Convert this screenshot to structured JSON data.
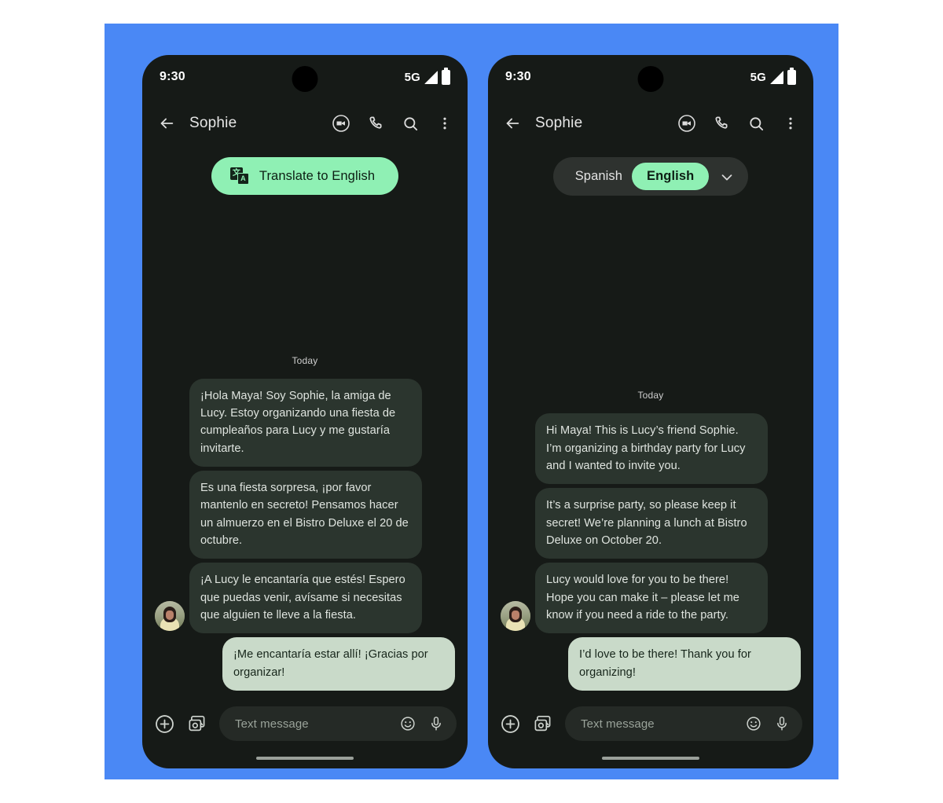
{
  "theme": {
    "poster_background": "#4a88f5",
    "phone_background": "#161a17",
    "accent_green": "#8ff0b4",
    "incoming_bubble": "#2b352e",
    "outgoing_bubble": "#c9dac9"
  },
  "phones": [
    {
      "id": "left",
      "status_bar": {
        "time": "9:30",
        "network": "5G",
        "signal_icon": "signal-bars-icon",
        "battery_icon": "battery-full-icon"
      },
      "app_bar": {
        "back_icon": "back-arrow-icon",
        "contact_name": "Sophie",
        "actions": [
          {
            "name": "video-call-icon",
            "label": "Video call"
          },
          {
            "name": "phone-call-icon",
            "label": "Call"
          },
          {
            "name": "search-icon",
            "label": "Search"
          },
          {
            "name": "overflow-menu-icon",
            "label": "More options"
          }
        ]
      },
      "top_control": {
        "kind": "translate_chip",
        "icon": "translate-icon",
        "label": "Translate to English"
      },
      "conversation": {
        "day_separator": "Today",
        "messages": [
          {
            "direction": "in",
            "text": "¡Hola Maya! Soy Sophie, la amiga de Lucy. Estoy organizando una fiesta de cumpleaños para Lucy y me gustaría invitarte."
          },
          {
            "direction": "in",
            "text": "Es una fiesta sorpresa, ¡por favor mantenlo en secreto! Pensamos hacer un almuerzo en el Bistro Deluxe el 20 de octubre."
          },
          {
            "direction": "in",
            "text": "¡A Lucy le encantaría que estés! Espero que puedas venir, avísame si necesitas que alguien te lleve a la fiesta.",
            "avatar": true
          },
          {
            "direction": "out",
            "text": "¡Me encantaría estar allí! ¡Gracias por organizar!"
          }
        ]
      },
      "composer": {
        "attach_icon": "plus-circle-icon",
        "gallery_icon": "gallery-camera-icon",
        "placeholder": "Text message",
        "emoji_icon": "emoji-smiley-icon",
        "mic_icon": "microphone-icon"
      }
    },
    {
      "id": "right",
      "status_bar": {
        "time": "9:30",
        "network": "5G",
        "signal_icon": "signal-bars-icon",
        "battery_icon": "battery-full-icon"
      },
      "app_bar": {
        "back_icon": "back-arrow-icon",
        "contact_name": "Sophie",
        "actions": [
          {
            "name": "video-call-icon",
            "label": "Video call"
          },
          {
            "name": "phone-call-icon",
            "label": "Call"
          },
          {
            "name": "search-icon",
            "label": "Search"
          },
          {
            "name": "overflow-menu-icon",
            "label": "More options"
          }
        ]
      },
      "top_control": {
        "kind": "language_toggle",
        "source_language": "Spanish",
        "target_language": "English",
        "selected": "English",
        "caret_icon": "chevron-down-icon"
      },
      "conversation": {
        "day_separator": "Today",
        "messages": [
          {
            "direction": "in",
            "text": "Hi Maya! This is Lucy’s friend Sophie. I’m organizing a birthday party for Lucy and I wanted to invite you."
          },
          {
            "direction": "in",
            "text": "It’s a surprise party, so please keep it secret! We’re planning a lunch at Bistro Deluxe on October 20."
          },
          {
            "direction": "in",
            "text": "Lucy would love for you to be there! Hope you can make it – please let me know if you need a ride to the party.",
            "avatar": true
          },
          {
            "direction": "out",
            "text": "I’d love to be there! Thank you for organizing!"
          }
        ]
      },
      "composer": {
        "attach_icon": "plus-circle-icon",
        "gallery_icon": "gallery-camera-icon",
        "placeholder": "Text message",
        "emoji_icon": "emoji-smiley-icon",
        "mic_icon": "microphone-icon"
      }
    }
  ]
}
